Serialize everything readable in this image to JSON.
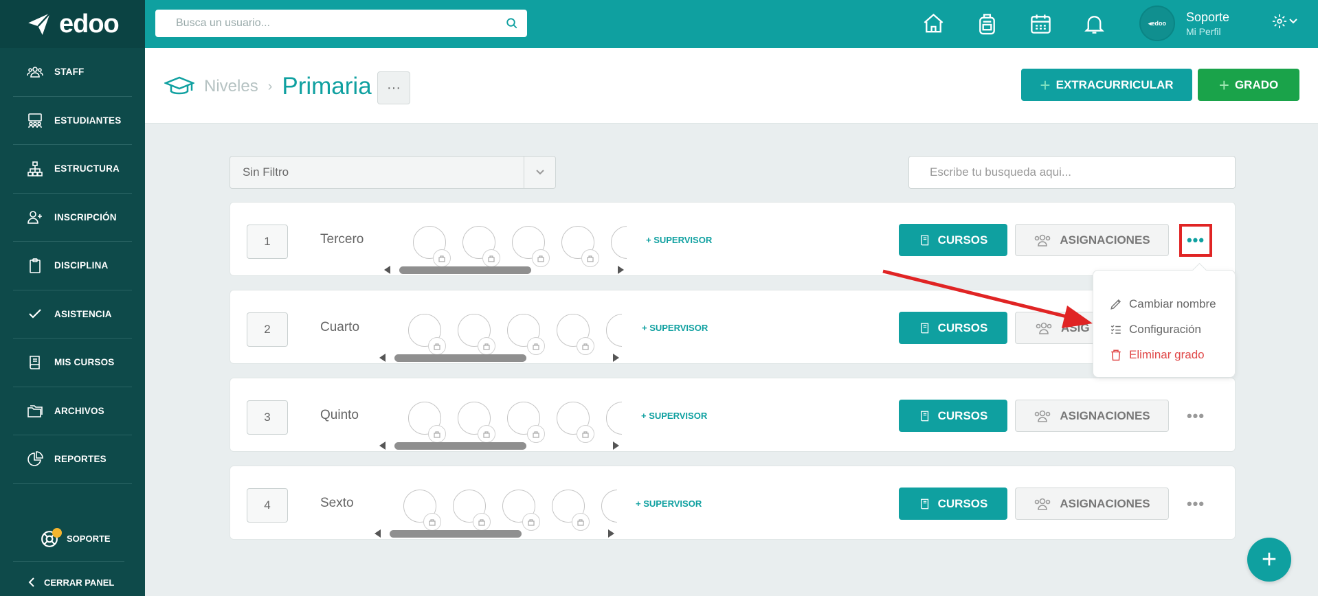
{
  "app": {
    "name": "edoo"
  },
  "topbar": {
    "search_placeholder": "Busca un usuario...",
    "icons": [
      "home-icon",
      "backpack-icon",
      "calendar-icon",
      "bell-icon"
    ],
    "profile": {
      "name": "Soporte",
      "subtitle": "Mi Perfil",
      "avatar_text": "◂edoo"
    }
  },
  "sidebar": {
    "items": [
      {
        "label": "STAFF",
        "icon": "staff-icon"
      },
      {
        "label": "ESTUDIANTES",
        "icon": "students-icon"
      },
      {
        "label": "ESTRUCTURA",
        "icon": "structure-icon"
      },
      {
        "label": "INSCRIPCIÓN",
        "icon": "add-user-icon"
      },
      {
        "label": "DISCIPLINA",
        "icon": "clipboard-icon"
      },
      {
        "label": "ASISTENCIA",
        "icon": "check-icon"
      },
      {
        "label": "MIS CURSOS",
        "icon": "book-icon"
      },
      {
        "label": "ARCHIVOS",
        "icon": "folders-icon"
      },
      {
        "label": "REPORTES",
        "icon": "pie-chart-icon"
      }
    ],
    "support_label": "SOPORTE",
    "collapse_label": "CERRAR PANEL"
  },
  "header": {
    "breadcrumb_parent": "Niveles",
    "breadcrumb_sep": "›",
    "title": "Primaria",
    "more_label": "···",
    "btn_extracurricular": "EXTRACURRICULAR",
    "btn_grado": "GRADO",
    "plus": "+"
  },
  "filters": {
    "filter_value": "Sin Filtro",
    "search_placeholder": "Escribe tu busqueda aqui..."
  },
  "grades": [
    {
      "number": "1",
      "name": "Tercero",
      "supervisor": "+ SUPERVISOR",
      "courses": "CURSOS",
      "assignments": "ASIGNACIONES",
      "more": "•••"
    },
    {
      "number": "2",
      "name": "Cuarto",
      "supervisor": "+ SUPERVISOR",
      "courses": "CURSOS",
      "assignments": "ASIG",
      "more": ""
    },
    {
      "number": "3",
      "name": "Quinto",
      "supervisor": "+ SUPERVISOR",
      "courses": "CURSOS",
      "assignments": "ASIGNACIONES",
      "more": "•••"
    },
    {
      "number": "4",
      "name": "Sexto",
      "supervisor": "+ SUPERVISOR",
      "courses": "CURSOS",
      "assignments": "ASIGNACIONES",
      "more": "•••"
    }
  ],
  "menu": {
    "items": [
      {
        "label": "Cambiar nombre",
        "icon": "pencil-icon"
      },
      {
        "label": "Configuración",
        "icon": "checklist-icon"
      },
      {
        "label": "Eliminar grado",
        "icon": "trash-icon"
      }
    ]
  },
  "fab_label": "+",
  "colors": {
    "primary": "#0fa0a0",
    "sidebar": "#0e4a4a",
    "success": "#1aa34a",
    "danger": "#e02424"
  }
}
